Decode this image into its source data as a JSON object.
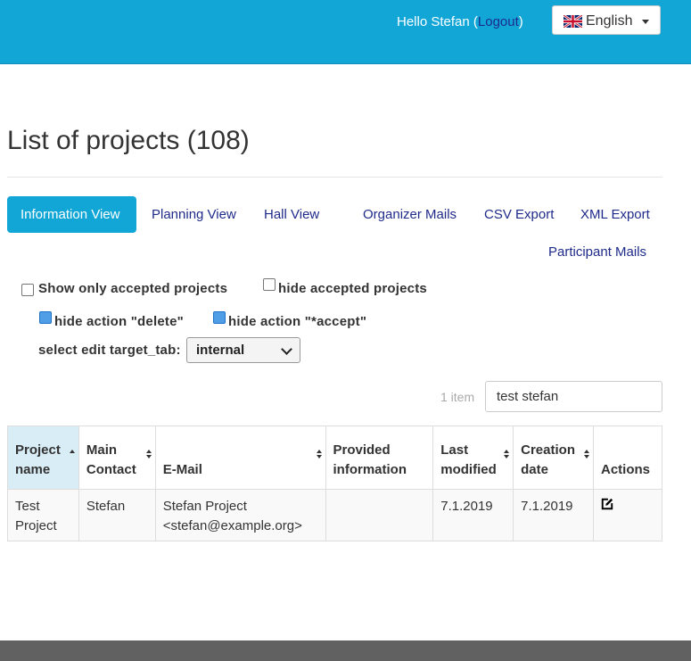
{
  "header": {
    "greeting": "Hello Stefan (",
    "logout": "Logout",
    "greeting_end": ")",
    "language": "English"
  },
  "page": {
    "title": "List of projects (108)"
  },
  "tabs": {
    "information_view": "Information View",
    "planning_view": "Planning View",
    "hall_view": "Hall View",
    "organizer_mails": "Organizer Mails",
    "csv_export": "CSV Export",
    "xml_export": "XML Export",
    "participant_mails": "Participant Mails"
  },
  "options": {
    "show_only_accepted": {
      "label": "Show only accepted projects",
      "checked": false
    },
    "hide_accepted": {
      "label": "hide accepted projects",
      "checked": false
    },
    "hide_action_delete": {
      "label": "hide action \"delete\"",
      "checked": true
    },
    "hide_action_accept": {
      "label": "hide action \"*accept\"",
      "checked": true
    },
    "edit_target_label": "select edit target_tab:",
    "edit_target_value": "internal"
  },
  "search": {
    "count": "1 item",
    "value": "test stefan"
  },
  "table": {
    "headers": {
      "project_name": "Project name",
      "main_contact": "Main Contact",
      "email": "E-Mail",
      "provided_information": "Provided information",
      "last_modified": "Last modified",
      "creation_date": "Creation date",
      "actions": "Actions"
    },
    "rows": [
      {
        "project_name": "Test Project",
        "main_contact": "Stefan",
        "email_name": "Stefan Project",
        "email_address": "<stefan@example.org>",
        "provided_information": "",
        "last_modified": "7.1.2019",
        "creation_date": "7.1.2019"
      }
    ]
  },
  "colors": {
    "primary": "#11a6d6",
    "link": "#1f2b8a",
    "footer": "#616161",
    "sorted_header": "#d9edf7"
  },
  "icons": {
    "flag": "uk-flag-icon",
    "edit": "edit-icon"
  }
}
